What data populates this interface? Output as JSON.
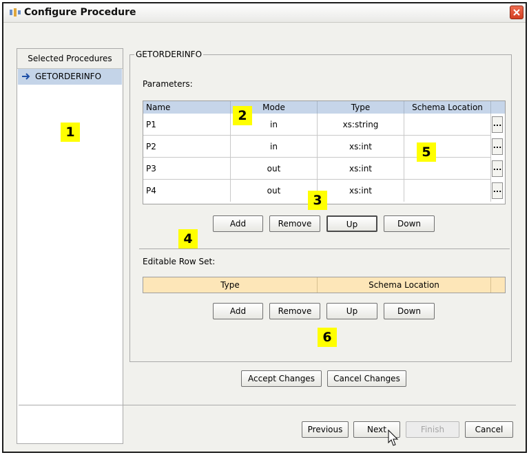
{
  "window": {
    "title": "Configure Procedure"
  },
  "left_panel": {
    "header": "Selected Procedures",
    "items": [
      {
        "label": "GETORDERINFO"
      }
    ]
  },
  "group": {
    "title": "GETORDERINFO",
    "parameters_label": "Parameters:",
    "columns": [
      "Name",
      "Mode",
      "Type",
      "Schema Location"
    ],
    "rows": [
      {
        "name": "P1",
        "mode": "in",
        "type": "xs:string",
        "schema": ""
      },
      {
        "name": "P2",
        "mode": "in",
        "type": "xs:int",
        "schema": ""
      },
      {
        "name": "P3",
        "mode": "out",
        "type": "xs:int",
        "schema": ""
      },
      {
        "name": "P4",
        "mode": "out",
        "type": "xs:int",
        "schema": ""
      }
    ],
    "browse_label": "...",
    "param_buttons": {
      "add": "Add",
      "remove": "Remove",
      "up": "Up",
      "down": "Down"
    },
    "rowset_label": "Editable Row Set:",
    "rowset_columns": [
      "Type",
      "Schema Location"
    ],
    "rowset_buttons": {
      "add": "Add",
      "remove": "Remove",
      "up": "Up",
      "down": "Down"
    }
  },
  "actions": {
    "accept": "Accept Changes",
    "cancel_changes": "Cancel Changes"
  },
  "nav": {
    "previous": "Previous",
    "next": "Next",
    "finish": "Finish",
    "cancel": "Cancel"
  },
  "callouts": [
    "1",
    "2",
    "3",
    "4",
    "5",
    "6"
  ],
  "colors": {
    "table_header": "#c6d5e9",
    "rowset_header": "#fde6b8",
    "callout": "#ffff00",
    "selected_item": "#c4d4e8"
  }
}
